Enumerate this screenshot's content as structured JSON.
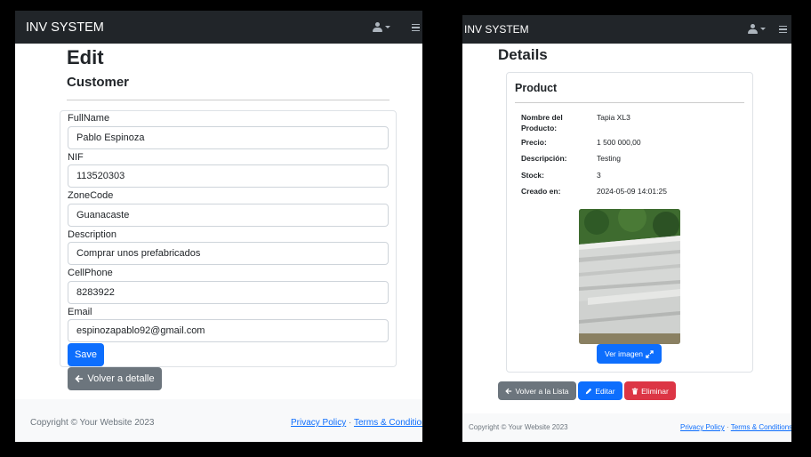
{
  "left": {
    "brand": "INV SYSTEM",
    "title": "Edit",
    "subtitle": "Customer",
    "fields": [
      {
        "label": "FullName",
        "value": "Pablo Espinoza"
      },
      {
        "label": "NIF",
        "value": "113520303"
      },
      {
        "label": "ZoneCode",
        "value": "Guanacaste"
      },
      {
        "label": "Description",
        "value": "Comprar unos prefabricados"
      },
      {
        "label": "CellPhone",
        "value": "8283922"
      },
      {
        "label": "Email",
        "value": "espinozapablo92@gmail.com"
      }
    ],
    "save_label": "Save",
    "back_label": "Volver a detalle",
    "footer": {
      "copyright": "Copyright © Your Website 2023",
      "privacy": "Privacy Policy",
      "separator": "·",
      "terms": "Terms & Conditions"
    }
  },
  "right": {
    "brand": "INV SYSTEM",
    "title": "Details",
    "card_title": "Product",
    "details": [
      {
        "label": "Nombre del Producto:",
        "value": "Tapia XL3"
      },
      {
        "label": "Precio:",
        "value": "1 500 000,00"
      },
      {
        "label": "Descripción:",
        "value": "Testing"
      },
      {
        "label": "Stock:",
        "value": "3"
      },
      {
        "label": "Creado en:",
        "value": "2024-05-09 14:01:25"
      }
    ],
    "ver_imagen_label": "Ver imagen",
    "back_label": "Volver a la Lista",
    "edit_label": "Editar",
    "delete_label": "Eliminar",
    "footer": {
      "copyright": "Copyright © Your Website 2023",
      "privacy": "Privacy Policy",
      "separator": "·",
      "terms": "Terms & Conditions"
    }
  },
  "colors": {
    "navbar": "#212529",
    "primary": "#0d6efd",
    "secondary": "#6c757d",
    "danger": "#dc3545",
    "footer_bg": "#f8f9fa"
  },
  "icons": [
    "user-icon",
    "caret-down-icon",
    "menu-icon",
    "arrow-left-icon",
    "expand-icon",
    "pencil-icon",
    "trash-icon"
  ]
}
